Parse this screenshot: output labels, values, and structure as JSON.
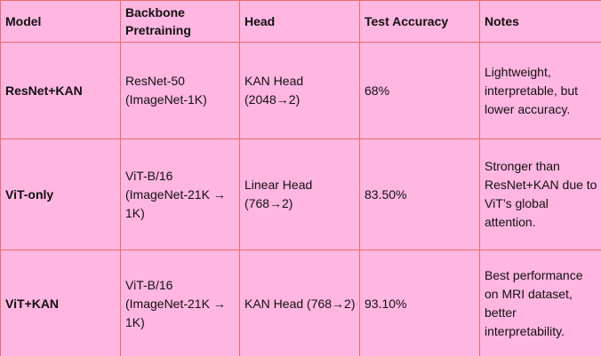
{
  "table": {
    "headers": [
      "Model",
      "Backbone Pretraining",
      "Head",
      "Test Accuracy",
      "Notes"
    ],
    "rows": [
      {
        "model": "ResNet+KAN",
        "backbone": "ResNet-50 (ImageNet-1K)",
        "head": "KAN Head (2048→2)",
        "accuracy": "68%",
        "notes": "Lightweight, interpretable, but lower accuracy."
      },
      {
        "model": "ViT-only",
        "backbone": "ViT-B/16 (ImageNet-21K → 1K)",
        "head": "Linear Head (768→2)",
        "accuracy": "83.50%",
        "notes": "Stronger than ResNet+KAN due to ViT’s global attention."
      },
      {
        "model": "ViT+KAN",
        "backbone": "ViT-B/16 (ImageNet-21K → 1K)",
        "head": "KAN Head (768→2)",
        "accuracy": "93.10%",
        "notes": "Best performance on MRI dataset, better interpretability."
      }
    ]
  }
}
